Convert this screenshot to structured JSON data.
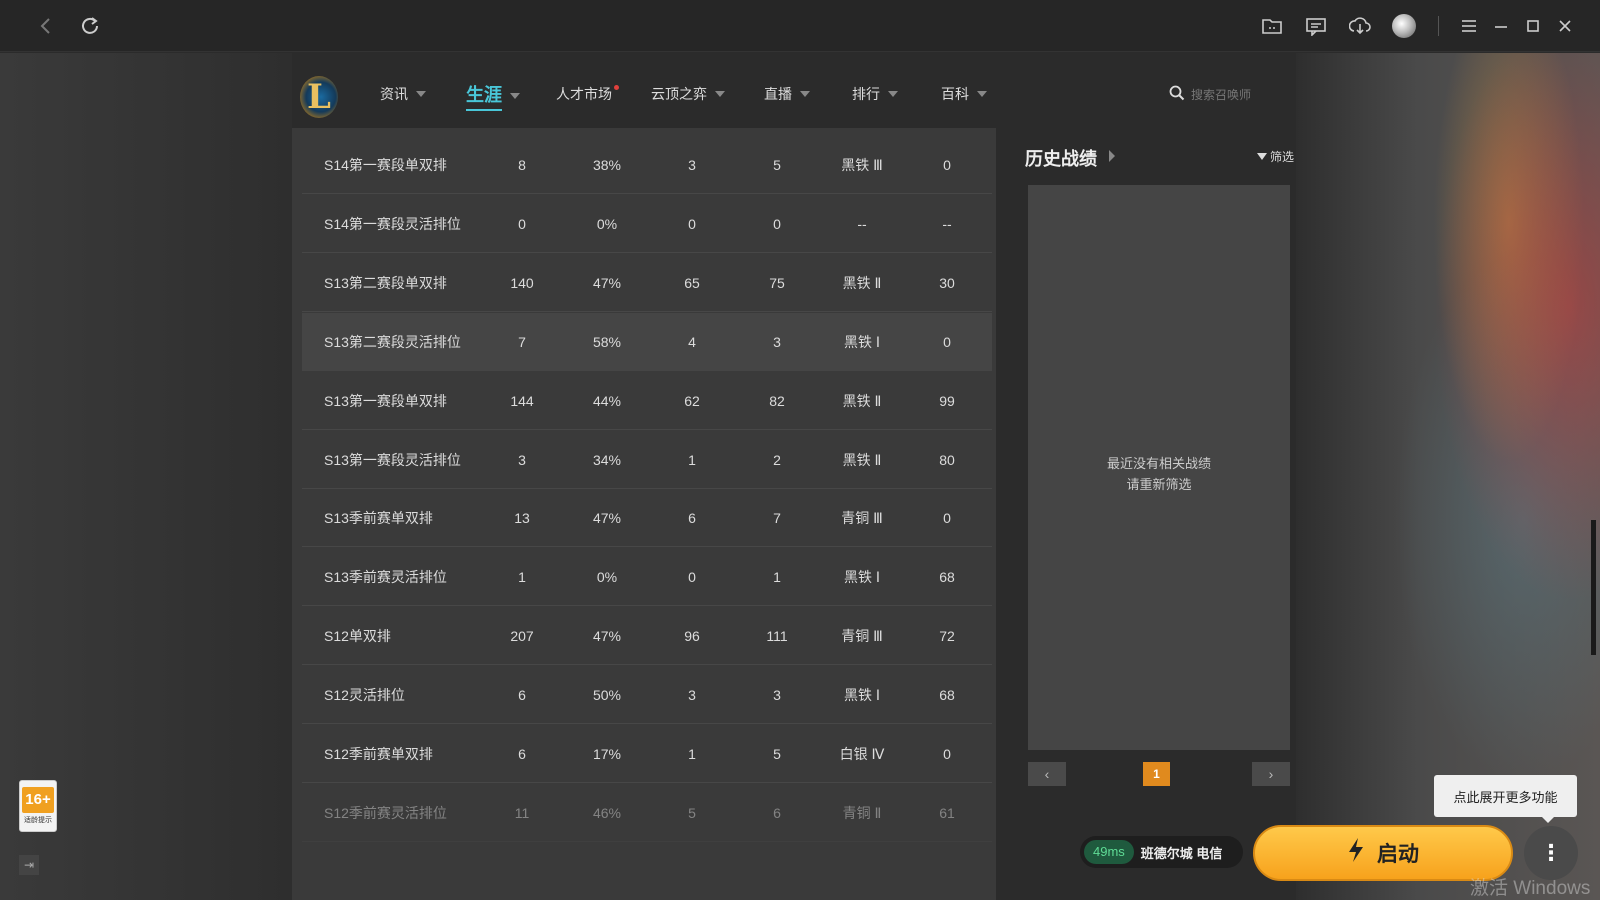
{
  "window": {
    "icons": [
      "back-icon",
      "refresh-icon",
      "folder-icon",
      "message-icon",
      "download-icon",
      "avatar",
      "menu-icon",
      "minimize-icon",
      "maximize-icon",
      "close-icon"
    ]
  },
  "nav": {
    "items": [
      {
        "label": "资讯",
        "has_caret": true
      },
      {
        "label": "生涯",
        "has_caret": true,
        "active": true
      },
      {
        "label": "人才市场",
        "has_dot": true
      },
      {
        "label": "云顶之弈",
        "has_caret": true
      },
      {
        "label": "直播",
        "has_caret": true
      },
      {
        "label": "排行",
        "has_caret": true
      },
      {
        "label": "百科",
        "has_caret": true
      }
    ],
    "search_placeholder": "搜索召唤师",
    "accent_color": "#49c6d8"
  },
  "table": {
    "rows": [
      [
        "S14第一赛段单双排",
        "8",
        "38%",
        "3",
        "5",
        "黑铁 Ⅲ",
        "0"
      ],
      [
        "S14第一赛段灵活排位",
        "0",
        "0%",
        "0",
        "0",
        "--",
        "--"
      ],
      [
        "S13第二赛段单双排",
        "140",
        "47%",
        "65",
        "75",
        "黑铁 Ⅱ",
        "30"
      ],
      [
        "S13第二赛段灵活排位",
        "7",
        "58%",
        "4",
        "3",
        "黑铁 Ⅰ",
        "0"
      ],
      [
        "S13第一赛段单双排",
        "144",
        "44%",
        "62",
        "82",
        "黑铁 Ⅱ",
        "99"
      ],
      [
        "S13第一赛段灵活排位",
        "3",
        "34%",
        "1",
        "2",
        "黑铁 Ⅱ",
        "80"
      ],
      [
        "S13季前赛单双排",
        "13",
        "47%",
        "6",
        "7",
        "青铜 Ⅲ",
        "0"
      ],
      [
        "S13季前赛灵活排位",
        "1",
        "0%",
        "0",
        "1",
        "黑铁 Ⅰ",
        "68"
      ],
      [
        "S12单双排",
        "207",
        "47%",
        "96",
        "111",
        "青铜 Ⅲ",
        "72"
      ],
      [
        "S12灵活排位",
        "6",
        "50%",
        "3",
        "3",
        "黑铁 Ⅰ",
        "68"
      ],
      [
        "S12季前赛单双排",
        "6",
        "17%",
        "1",
        "5",
        "白银 Ⅳ",
        "0"
      ],
      [
        "S12季前赛灵活排位",
        "11",
        "46%",
        "5",
        "6",
        "青铜 Ⅱ",
        "61"
      ]
    ]
  },
  "history": {
    "title": "历史战绩",
    "filter_label": "筛选",
    "empty_line1": "最近没有相关战绩",
    "empty_line2": "请重新筛选",
    "page": "1",
    "prev": "‹",
    "next": "›"
  },
  "age_rating": {
    "num": "16+",
    "sub": "适龄提示"
  },
  "launcher": {
    "ping": "49ms",
    "server": "班德尔城 电信",
    "launch_label": "启动",
    "more_tooltip": "点此展开更多功能",
    "brand_color": "#f7a21c"
  },
  "watermark": "激活 Windows"
}
